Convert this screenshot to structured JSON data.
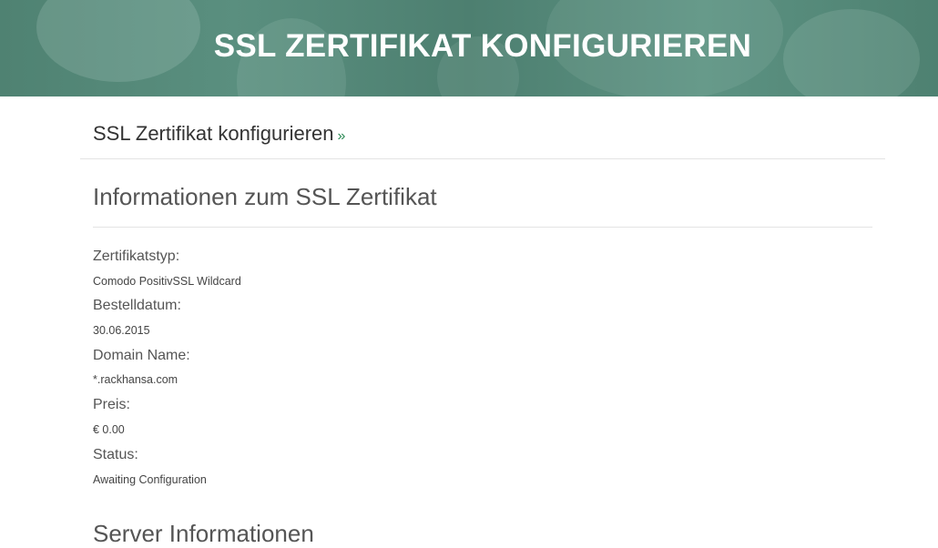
{
  "header": {
    "title": "SSL ZERTIFIKAT KONFIGURIEREN"
  },
  "breadcrumb": {
    "label": "SSL Zertifikat konfigurieren",
    "separator": "»"
  },
  "certificate_info": {
    "title": "Informationen zum SSL Zertifikat",
    "fields": [
      {
        "label": "Zertifikatstyp:",
        "value": "Comodo PositivSSL Wildcard"
      },
      {
        "label": "Bestelldatum:",
        "value": "30.06.2015"
      },
      {
        "label": "Domain Name:",
        "value": "*.rackhansa.com"
      },
      {
        "label": "Preis:",
        "value": "€ 0.00"
      },
      {
        "label": "Status:",
        "value": "Awaiting Configuration"
      }
    ]
  },
  "server_info": {
    "title": "Server Informationen"
  },
  "colors": {
    "header_bg": "#558a7a",
    "accent": "#2e8b57",
    "text": "#555555"
  }
}
